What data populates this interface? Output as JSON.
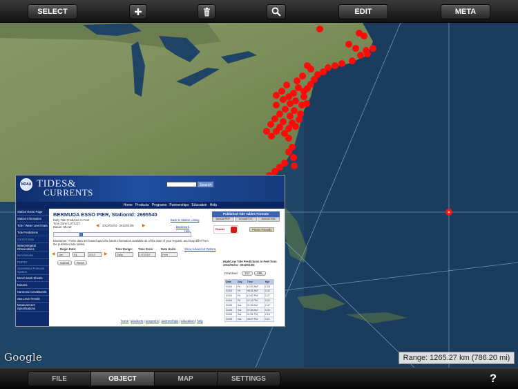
{
  "toolbar": {
    "select_label": "SELECT",
    "add_icon": "plus-icon",
    "delete_icon": "trash-icon",
    "search_icon": "magnifier-icon",
    "edit_label": "EDIT",
    "meta_label": "META"
  },
  "map": {
    "provider_logo": "Google",
    "range_text": "Range: 1265.27 km (786.20 mi)",
    "marker_color": "#ff0a0a"
  },
  "webpage": {
    "logo_line1": "TIDES&",
    "logo_line2": "CURRENTS",
    "search_button": "Search",
    "nav": [
      "Home",
      "Products",
      "Programs",
      "Partnerships",
      "Education",
      "Help"
    ],
    "sidebar": [
      "Station Home Page",
      "Station Information",
      "Tide / Water Level Data",
      "Tide Predictions",
      "Current Data",
      "Meteorological Observations",
      "Benchmarks",
      "PORTS",
      "Operational Forecast System",
      "Bench Mark Sheets",
      "Datums",
      "Harmonic Constituents",
      "Sea Level Trends",
      "Measurement Specifications"
    ],
    "station_title": "BERMUDA ESSO PIER,  StationId: 2695540",
    "info_lines": [
      "Daily Tide Prediction in Feet",
      "Time Zone: LST/LDT",
      "Datum: MLLW"
    ],
    "date_range": "2012/01/04 - 2012/01/05",
    "back_link": "Back to Station Listing",
    "bookmark_link": "Bookmark",
    "help_link": "Help",
    "disclaimer": "Disclaimer: These data are based upon the latest information available as of the date of your request, and may differ from the published tide tables.",
    "form_labels": [
      "Begin Date:",
      "Time Range:",
      "Time Zone:",
      "Data Units:"
    ],
    "form_values": [
      "Jan",
      "04",
      "2012",
      "Daily",
      "LST/LDT",
      "Feet"
    ],
    "advanced_link": "Show Advanced Options",
    "submit_label": "Submit",
    "reset_label": "Reset",
    "pub_header": "Published Tide Tables Formats",
    "pub_tabs": [
      "Annual PDF",
      "Annual TXT",
      "Annual XML"
    ],
    "reader_label": "Reader",
    "printer_label": "Printer Friendly",
    "hilo_title": "High/Low Tide Predictions in Feet from 2012/01/04 - 2012/01/05",
    "download_label": "Download:",
    "download_opts": [
      "TXT",
      "XML"
    ],
    "table_headers": [
      "Date",
      "Day",
      "Time",
      "Hgt"
    ],
    "table_rows": [
      [
        "01/04",
        "Fri",
        "12:43 AM",
        "2.28"
      ],
      [
        "01/04",
        "Fri",
        "06:51 AM",
        "0.32"
      ],
      [
        "01/04",
        "Fri",
        "12:52 PM",
        "2.27"
      ],
      [
        "01/04",
        "Fri",
        "07:11 PM",
        "0.22"
      ],
      [
        "01/05",
        "Sat",
        "01:28 AM",
        "2.47"
      ],
      [
        "01/05",
        "Sat",
        "07:38 AM",
        "0.34"
      ],
      [
        "01/05",
        "Sat",
        "01:51 PM",
        "2.16"
      ],
      [
        "01/05",
        "Sat",
        "08:07 PM",
        "0.21"
      ]
    ],
    "footer_links": [
      "home",
      "products",
      "programs",
      "partnerships",
      "education",
      "help"
    ]
  },
  "bottom": {
    "tabs": [
      "FILE",
      "OBJECT",
      "MAP",
      "SETTINGS"
    ],
    "active_tab": "OBJECT",
    "help_label": "?"
  }
}
